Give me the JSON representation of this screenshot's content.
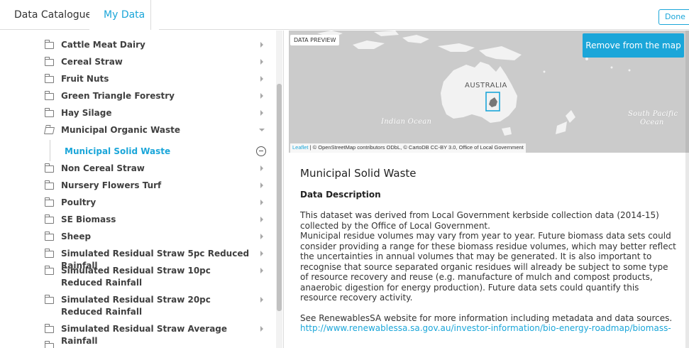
{
  "tabs": {
    "catalogue": "Data Catalogue",
    "mydata": "My Data"
  },
  "done_label": "Done",
  "tree": {
    "items": [
      {
        "label": "Cattle Meat Dairy"
      },
      {
        "label": "Cereal Straw"
      },
      {
        "label": "Fruit Nuts"
      },
      {
        "label": "Green Triangle Forestry"
      },
      {
        "label": "Hay Silage"
      },
      {
        "label": "Municipal Organic Waste"
      },
      {
        "label": "Municipal Solid Waste"
      },
      {
        "label": "Non Cereal Straw"
      },
      {
        "label": "Nursery Flowers Turf"
      },
      {
        "label": "Poultry"
      },
      {
        "label": "SE Biomass"
      },
      {
        "label": "Sheep"
      },
      {
        "label": "Simulated Residual Straw 5pc Reduced Rainfall"
      },
      {
        "label": "Simulated Residual Straw 10pc Reduced Rainfall"
      },
      {
        "label": "Simulated Residual Straw 20pc Reduced Rainfall"
      },
      {
        "label": "Simulated Residual Straw Average Rainfall"
      }
    ]
  },
  "map": {
    "badge": "DATA PREVIEW",
    "remove_label": "Remove from the map",
    "attribution_link": "Leaflet",
    "attribution_text": " | © OpenStreetMap contributors ODbL, © CartoDB CC-BY 3.0, Office of Local Government",
    "labels": {
      "australia": "AUSTRALIA",
      "indian_ocean": "Indian Ocean",
      "south_pacific_1": "South Pacific",
      "south_pacific_2": "Ocean"
    }
  },
  "detail": {
    "title": "Municipal Solid Waste",
    "subtitle": "Data Description",
    "description": "This dataset was derived from Local Government kerbside collection data (2014-15) collected by the Office of Local Government.",
    "description_2": "Municipal residue volumes may vary from year to year. Future biomass data sets could consider providing a range for these biomass residue volumes, which may better reflect the uncertainties in annual volumes that may be generated. It is also important to recognise that source separated organic residues will already be subject to some type of resource recovery and reuse (e.g. manufacture of mulch and compost products, anaerobic digestion for energy production). Future data sets could quantify this resource recovery activity.",
    "see_also": "See RenewablesSA website for more information including metadata and data sources.",
    "link": "http://www.renewablessa.sa.gov.au/investor-information/bio-energy-roadmap/biomass-"
  },
  "colors": {
    "accent": "#1ba6d9",
    "map_water": "#cbcbcb",
    "map_land": "#f2f2f2"
  }
}
